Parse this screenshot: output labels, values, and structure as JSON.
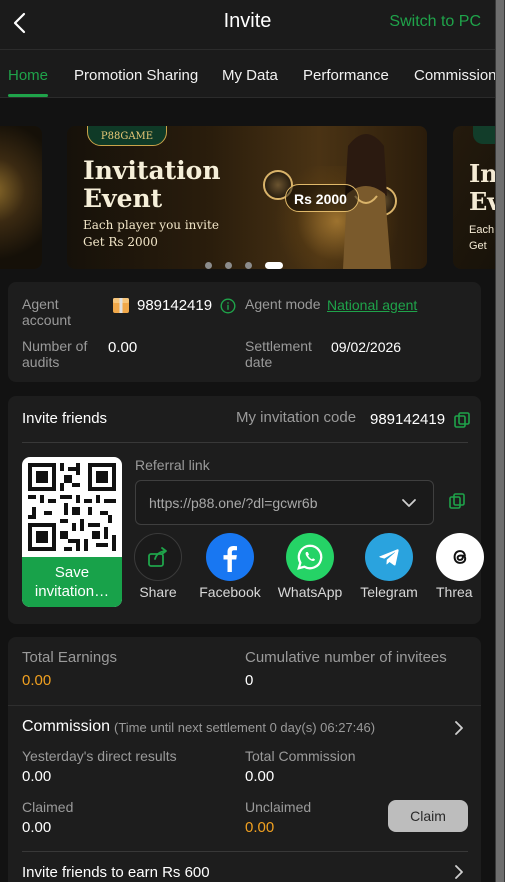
{
  "header": {
    "title": "Invite",
    "switch_label": "Switch to PC"
  },
  "tabs": [
    {
      "label": "Home",
      "active": true
    },
    {
      "label": "Promotion Sharing"
    },
    {
      "label": "My Data"
    },
    {
      "label": "Performance"
    },
    {
      "label": "Commission"
    }
  ],
  "banner": {
    "logo": "P88GAME",
    "title_line1": "Invitation",
    "title_line2": "Event",
    "sub_line1": "Each player you invite",
    "sub_line2": "Get Rs 2000",
    "chip_text": "Rs 2000",
    "right_title1": "In",
    "right_title2": "Ev",
    "right_sub1": "Each",
    "right_sub2": "Get",
    "active_slide_index": 3,
    "slide_count": 4
  },
  "agent": {
    "account_label": "Agent account",
    "account_value": "989142419",
    "mode_label": "Agent mode",
    "mode_value": "National agent",
    "audits_label": "Number of audits",
    "audits_value": "0.00",
    "settlement_label": "Settlement date",
    "settlement_value": "09/02/2026"
  },
  "invite": {
    "title": "Invite friends",
    "code_label": "My invitation code",
    "code_value": "989142419",
    "referral_label": "Referral link",
    "referral_value": "https://p88.one/?dl=gcwr6b",
    "save_label": "Save invitation…",
    "share": [
      {
        "name": "Share",
        "icon": "share-icon"
      },
      {
        "name": "Facebook",
        "icon": "facebook-icon",
        "color": "#1877f2"
      },
      {
        "name": "WhatsApp",
        "icon": "whatsapp-icon",
        "color": "#25d366"
      },
      {
        "name": "Telegram",
        "icon": "telegram-icon",
        "color": "#2aa3de"
      },
      {
        "name": "Threa",
        "icon": "threads-icon"
      }
    ]
  },
  "earnings": {
    "total_label": "Total Earnings",
    "total_value": "0.00",
    "invitees_label": "Cumulative number of invitees",
    "invitees_value": "0"
  },
  "commission": {
    "title": "Commission",
    "next_settlement": "(Time until next settlement  0 day(s) 06:27:46)",
    "yesterday_label": "Yesterday's direct results",
    "yesterday_value": "0.00",
    "total_label": "Total Commission",
    "total_value": "0.00",
    "claimed_label": "Claimed",
    "claimed_value": "0.00",
    "unclaimed_label": "Unclaimed",
    "unclaimed_value": "0.00",
    "claim_button": "Claim"
  },
  "footer_row": {
    "label": "Invite friends to earn Rs 600"
  },
  "colors": {
    "accent": "#1fa34a",
    "orange": "#f0a020",
    "background": "#121212",
    "card": "#1d1d1d"
  }
}
